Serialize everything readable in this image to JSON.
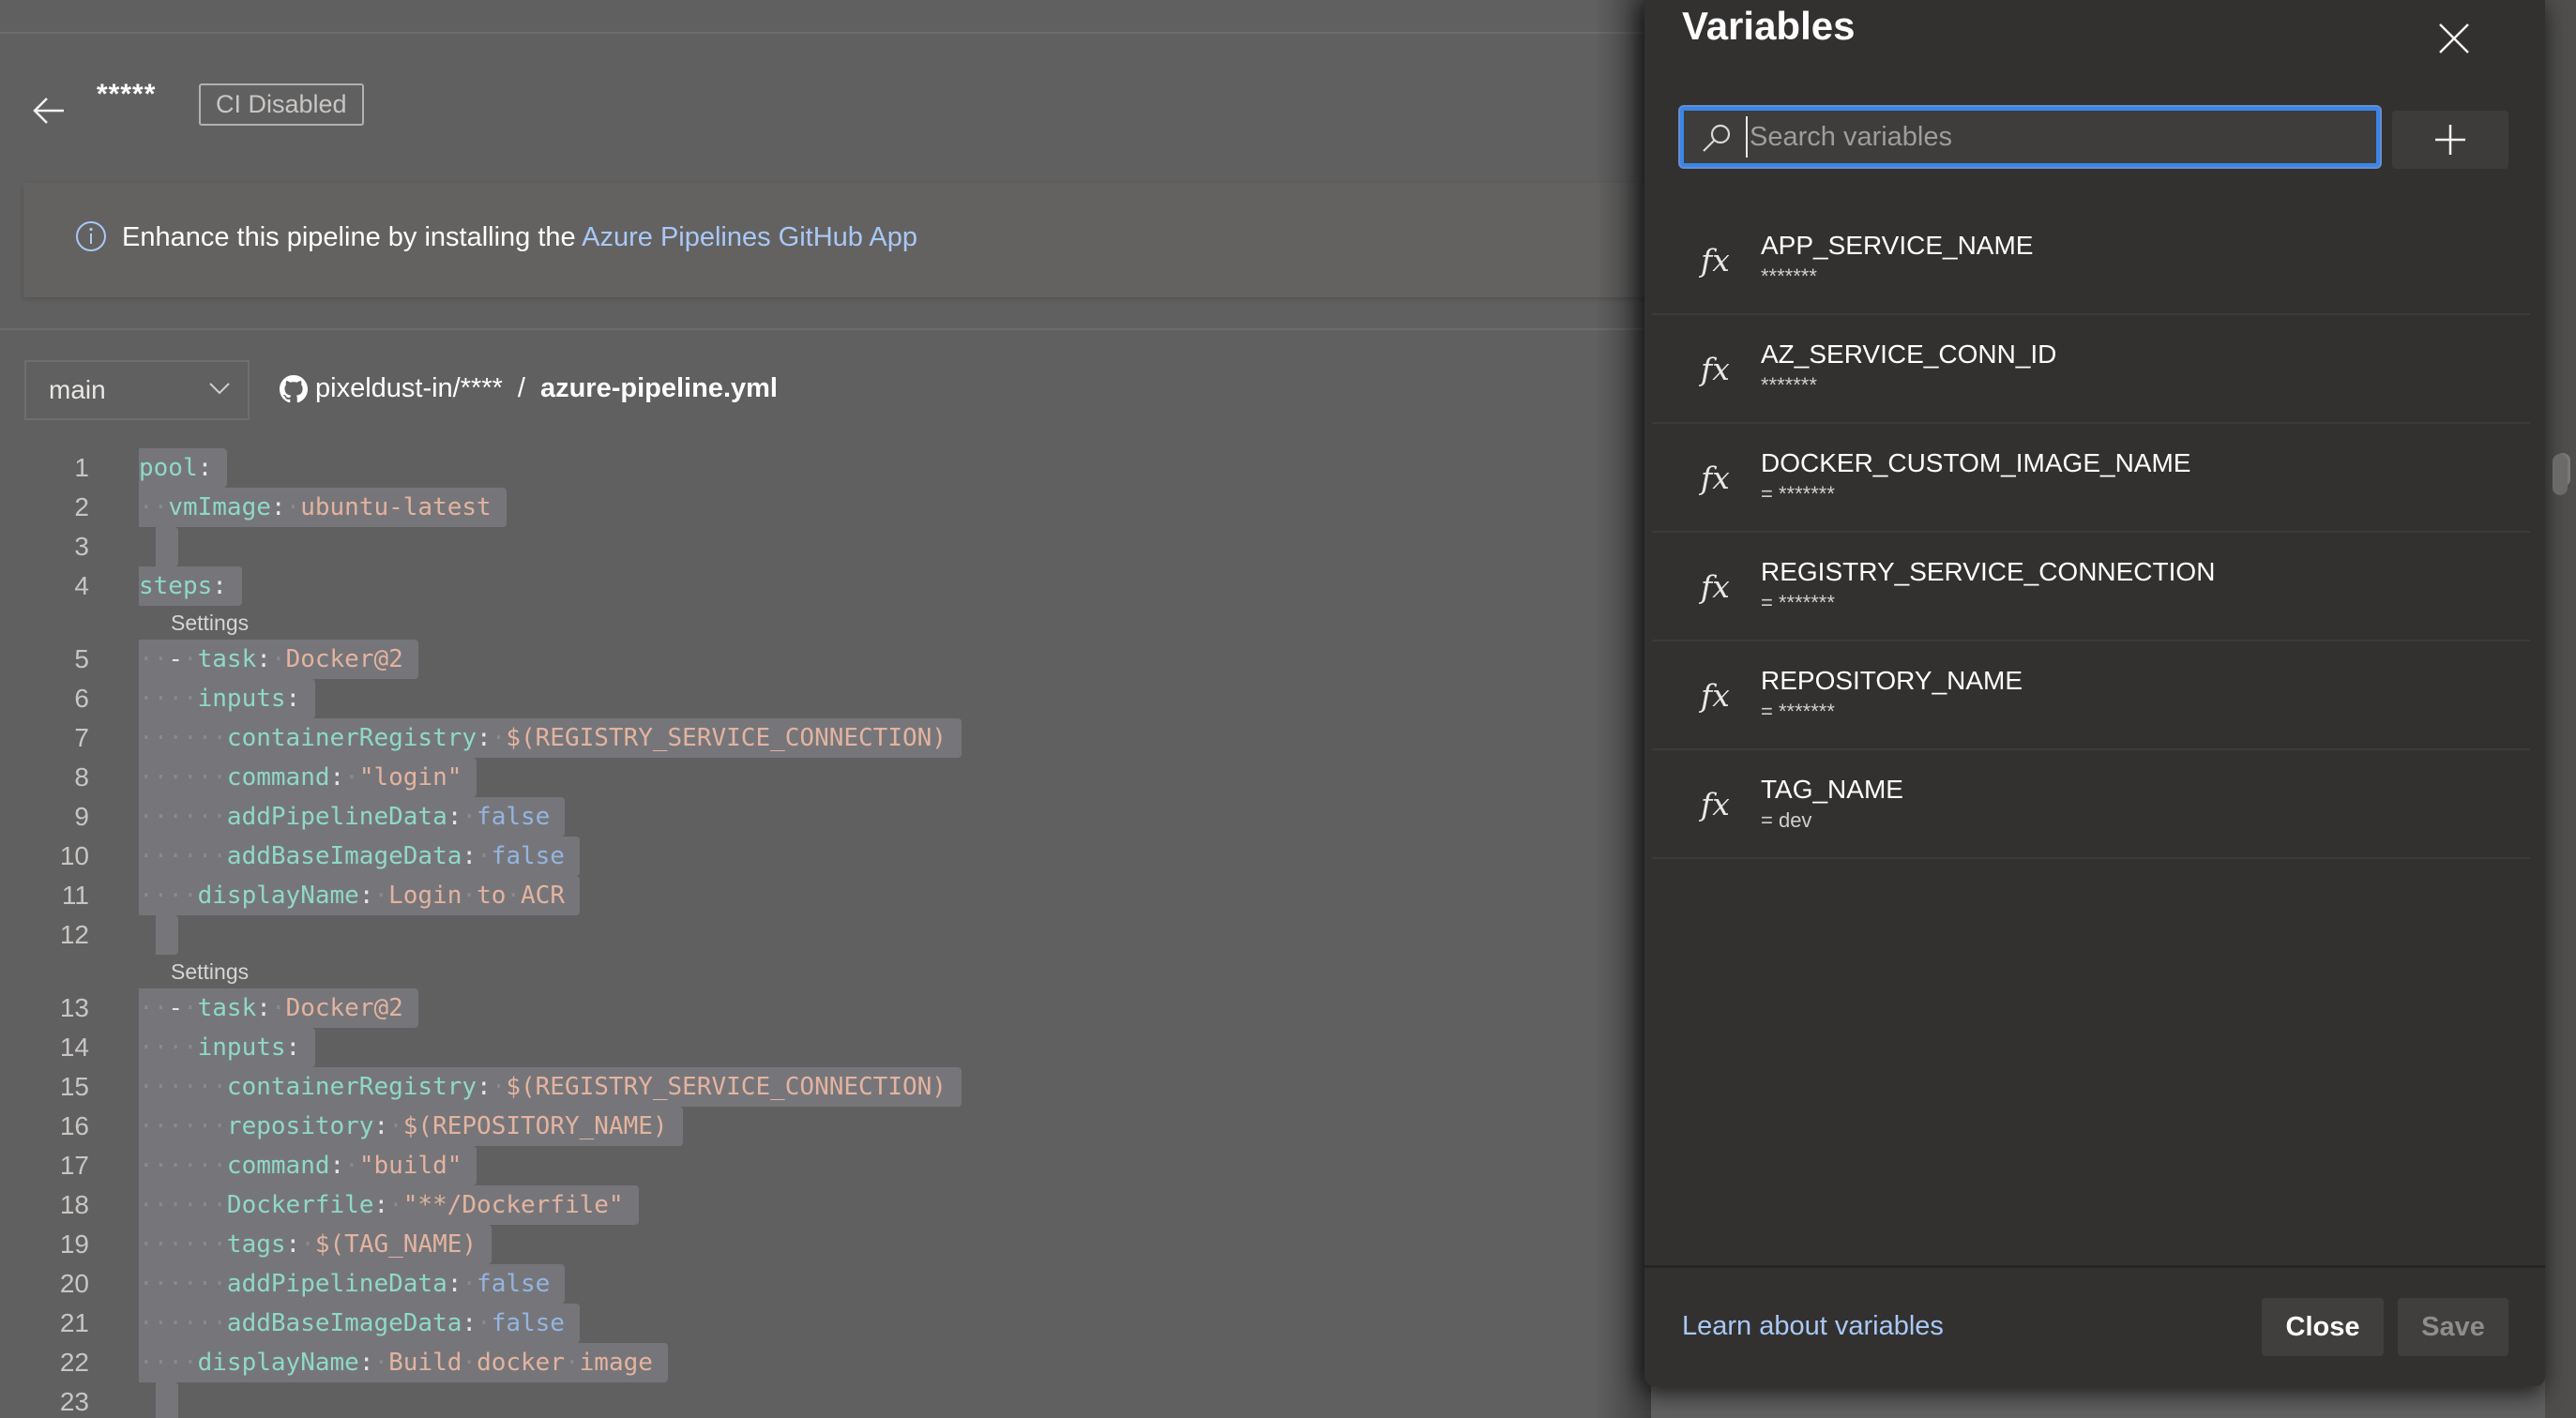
{
  "header": {
    "pipeline_title": "*****",
    "ci_badge": "CI Disabled"
  },
  "banner": {
    "text": "Enhance this pipeline by installing the ",
    "link": "Azure Pipelines GitHub App"
  },
  "repo": {
    "branch": "main",
    "repo_name": "pixeldust-in/****",
    "separator": "/",
    "file_name": "azure-pipeline.yml"
  },
  "editor": {
    "lens_label": "Settings",
    "lines": [
      {
        "n": "1",
        "indent": "",
        "tokens": [
          [
            "k",
            "pool"
          ],
          [
            "p",
            ":"
          ]
        ]
      },
      {
        "n": "2",
        "indent": "··",
        "tokens": [
          [
            "k",
            "vmImage"
          ],
          [
            "p",
            ":"
          ],
          [
            "dot",
            "·"
          ],
          [
            "s",
            "ubuntu-latest"
          ]
        ]
      },
      {
        "n": "3",
        "indent": "",
        "tokens": [],
        "empty": true
      },
      {
        "n": "4",
        "indent": "",
        "tokens": [
          [
            "k",
            "steps"
          ],
          [
            "p",
            ":"
          ]
        ],
        "lens_after": true
      },
      {
        "n": "5",
        "indent": "··",
        "tokens": [
          [
            "p",
            "-"
          ],
          [
            "dot",
            "·"
          ],
          [
            "k",
            "task"
          ],
          [
            "p",
            ":"
          ],
          [
            "dot",
            "·"
          ],
          [
            "s",
            "Docker@2"
          ]
        ]
      },
      {
        "n": "6",
        "indent": "····",
        "tokens": [
          [
            "k",
            "inputs"
          ],
          [
            "p",
            ":"
          ]
        ]
      },
      {
        "n": "7",
        "indent": "······",
        "tokens": [
          [
            "k",
            "containerRegistry"
          ],
          [
            "p",
            ":"
          ],
          [
            "dot",
            "·"
          ],
          [
            "s",
            "$(REGISTRY_SERVICE_CONNECTION)"
          ]
        ]
      },
      {
        "n": "8",
        "indent": "······",
        "tokens": [
          [
            "k",
            "command"
          ],
          [
            "p",
            ":"
          ],
          [
            "dot",
            "·"
          ],
          [
            "s",
            "\"login\""
          ]
        ]
      },
      {
        "n": "9",
        "indent": "······",
        "tokens": [
          [
            "k",
            "addPipelineData"
          ],
          [
            "p",
            ":"
          ],
          [
            "dot",
            "·"
          ],
          [
            "b",
            "false"
          ]
        ]
      },
      {
        "n": "10",
        "indent": "······",
        "tokens": [
          [
            "k",
            "addBaseImageData"
          ],
          [
            "p",
            ":"
          ],
          [
            "dot",
            "·"
          ],
          [
            "b",
            "false"
          ]
        ]
      },
      {
        "n": "11",
        "indent": "····",
        "tokens": [
          [
            "k",
            "displayName"
          ],
          [
            "p",
            ":"
          ],
          [
            "dot",
            "·"
          ],
          [
            "s",
            "Login"
          ],
          [
            "dot",
            "·"
          ],
          [
            "s",
            "to"
          ],
          [
            "dot",
            "·"
          ],
          [
            "s",
            "ACR"
          ]
        ]
      },
      {
        "n": "12",
        "indent": "",
        "tokens": [],
        "empty": true,
        "lens_after": true
      },
      {
        "n": "13",
        "indent": "··",
        "tokens": [
          [
            "p",
            "-"
          ],
          [
            "dot",
            "·"
          ],
          [
            "k",
            "task"
          ],
          [
            "p",
            ":"
          ],
          [
            "dot",
            "·"
          ],
          [
            "s",
            "Docker@2"
          ]
        ]
      },
      {
        "n": "14",
        "indent": "····",
        "tokens": [
          [
            "k",
            "inputs"
          ],
          [
            "p",
            ":"
          ]
        ]
      },
      {
        "n": "15",
        "indent": "······",
        "tokens": [
          [
            "k",
            "containerRegistry"
          ],
          [
            "p",
            ":"
          ],
          [
            "dot",
            "·"
          ],
          [
            "s",
            "$(REGISTRY_SERVICE_CONNECTION)"
          ]
        ]
      },
      {
        "n": "16",
        "indent": "······",
        "tokens": [
          [
            "k",
            "repository"
          ],
          [
            "p",
            ":"
          ],
          [
            "dot",
            "·"
          ],
          [
            "s",
            "$(REPOSITORY_NAME)"
          ]
        ]
      },
      {
        "n": "17",
        "indent": "······",
        "tokens": [
          [
            "k",
            "command"
          ],
          [
            "p",
            ":"
          ],
          [
            "dot",
            "·"
          ],
          [
            "s",
            "\"build\""
          ]
        ]
      },
      {
        "n": "18",
        "indent": "······",
        "tokens": [
          [
            "k",
            "Dockerfile"
          ],
          [
            "p",
            ":"
          ],
          [
            "dot",
            "·"
          ],
          [
            "s",
            "\"**/Dockerfile\""
          ]
        ]
      },
      {
        "n": "19",
        "indent": "······",
        "tokens": [
          [
            "k",
            "tags"
          ],
          [
            "p",
            ":"
          ],
          [
            "dot",
            "·"
          ],
          [
            "s",
            "$(TAG_NAME)"
          ]
        ]
      },
      {
        "n": "20",
        "indent": "······",
        "tokens": [
          [
            "k",
            "addPipelineData"
          ],
          [
            "p",
            ":"
          ],
          [
            "dot",
            "·"
          ],
          [
            "b",
            "false"
          ]
        ]
      },
      {
        "n": "21",
        "indent": "······",
        "tokens": [
          [
            "k",
            "addBaseImageData"
          ],
          [
            "p",
            ":"
          ],
          [
            "dot",
            "·"
          ],
          [
            "b",
            "false"
          ]
        ]
      },
      {
        "n": "22",
        "indent": "····",
        "tokens": [
          [
            "k",
            "displayName"
          ],
          [
            "p",
            ":"
          ],
          [
            "dot",
            "·"
          ],
          [
            "s",
            "Build"
          ],
          [
            "dot",
            "·"
          ],
          [
            "s",
            "docker"
          ],
          [
            "dot",
            "·"
          ],
          [
            "s",
            "image"
          ]
        ]
      },
      {
        "n": "23",
        "indent": "",
        "tokens": [],
        "empty": true
      }
    ]
  },
  "variables_panel": {
    "title": "Variables",
    "search_placeholder": "Search variables",
    "search_value": "",
    "items": [
      {
        "name": "APP_SERVICE_NAME",
        "value": "*******"
      },
      {
        "name": "AZ_SERVICE_CONN_ID",
        "value": "*******"
      },
      {
        "name": "DOCKER_CUSTOM_IMAGE_NAME",
        "value": "= *******"
      },
      {
        "name": "REGISTRY_SERVICE_CONNECTION",
        "value": "= *******"
      },
      {
        "name": "REPOSITORY_NAME",
        "value": "= *******"
      },
      {
        "name": "TAG_NAME",
        "value": "= dev"
      }
    ],
    "item_icon": "fx",
    "learn_link": "Learn about variables",
    "close_label": "Close",
    "save_label": "Save"
  },
  "colors": {
    "accent_link": "#a9c8f5",
    "focus_border": "#3a86e8",
    "panel_bg": "#323130",
    "yaml_key": "#8fd9c6",
    "yaml_string": "#e3b39f",
    "yaml_bool": "#93b5e0"
  }
}
